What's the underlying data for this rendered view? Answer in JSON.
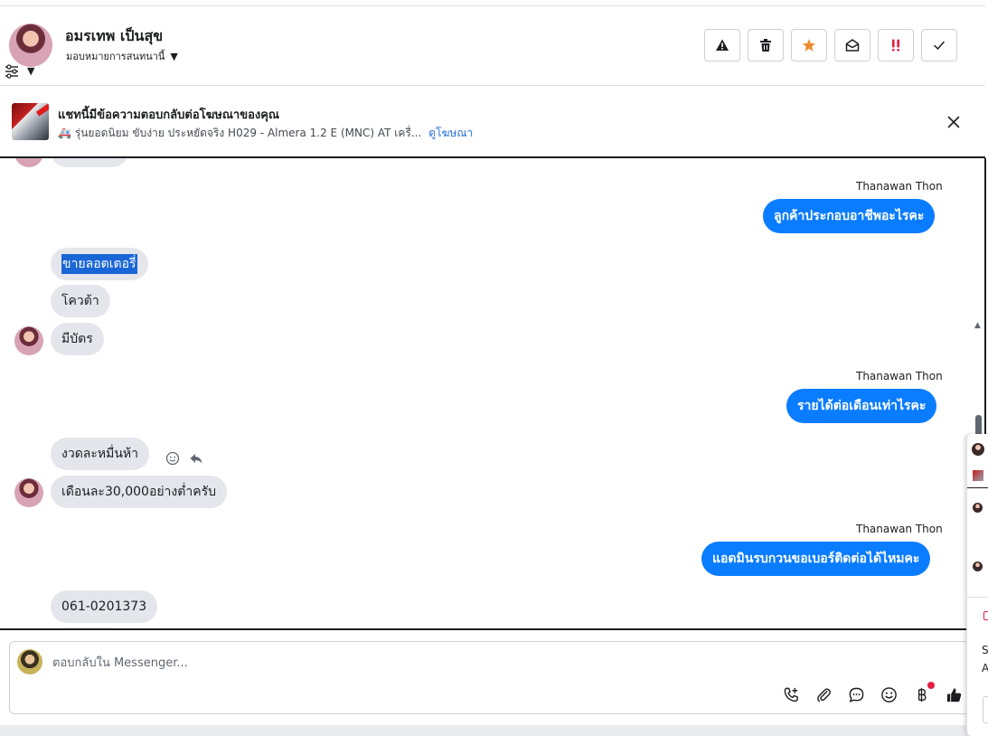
{
  "header": {
    "contact_name": "อมรเทพ เป็นสุข",
    "assign_label": "มอบหมายการสนทนานี้",
    "toolbar": [
      {
        "name": "report-button",
        "icon": "warning-icon"
      },
      {
        "name": "delete-button",
        "icon": "trash-icon"
      },
      {
        "name": "star-button",
        "icon": "star-icon"
      },
      {
        "name": "mark-unread-button",
        "icon": "envelope-open-icon"
      },
      {
        "name": "mark-important-button",
        "icon": "double-exclamation-icon"
      },
      {
        "name": "mark-done-button",
        "icon": "checkmark-icon"
      }
    ]
  },
  "ad_banner": {
    "title": "แชทนี้มีข้อความตอบกลับต่อโฆษณาของคุณ",
    "description": "🚑 รุ่นยอดนิยม ขับง่าย ประหยัดจริง H029 - Almera 1.2 E (MNC) AT เครื่...",
    "view_ad_label": "ดูโฆษณา"
  },
  "conversation": {
    "sender_name": "Thanawan Thon",
    "messages": [
      {
        "direction": "out",
        "sender": "Thanawan Thon",
        "text": "ลูกค้าประกอบอาชีพอะไรคะ"
      },
      {
        "direction": "in",
        "text": "ขายลอตเตอรี่",
        "selected": true
      },
      {
        "direction": "in",
        "text": "โควต้า"
      },
      {
        "direction": "in",
        "text": "มีบัตร"
      },
      {
        "direction": "out",
        "sender": "Thanawan Thon",
        "text": "รายได้ต่อเดือนเท่าไรคะ"
      },
      {
        "direction": "in",
        "text": "งวดละหมื่นห้า"
      },
      {
        "direction": "in",
        "text": "เดือนละ30,000อย่างต่ำครับ"
      },
      {
        "direction": "out",
        "sender": "Thanawan Thon",
        "text": "แอดมินรบกวนขอเบอร์ติดต่อได้ไหมคะ"
      },
      {
        "direction": "in",
        "text": "061-0201373"
      }
    ]
  },
  "composer": {
    "placeholder": "ตอบกลับใน Messenger...",
    "icons": [
      "phone-add-icon",
      "paperclip-icon",
      "saved-reply-icon",
      "emoji-icon",
      "baht-payment-icon",
      "thumbs-up-icon"
    ]
  },
  "side_panel": {
    "text_1": "S",
    "text_2": "A"
  },
  "colors": {
    "outgoing_bubble": "#0a7cff",
    "incoming_bubble": "#e4e6eb",
    "link": "#216fdb",
    "star": "#f0892b",
    "important": "#e41e3f"
  }
}
